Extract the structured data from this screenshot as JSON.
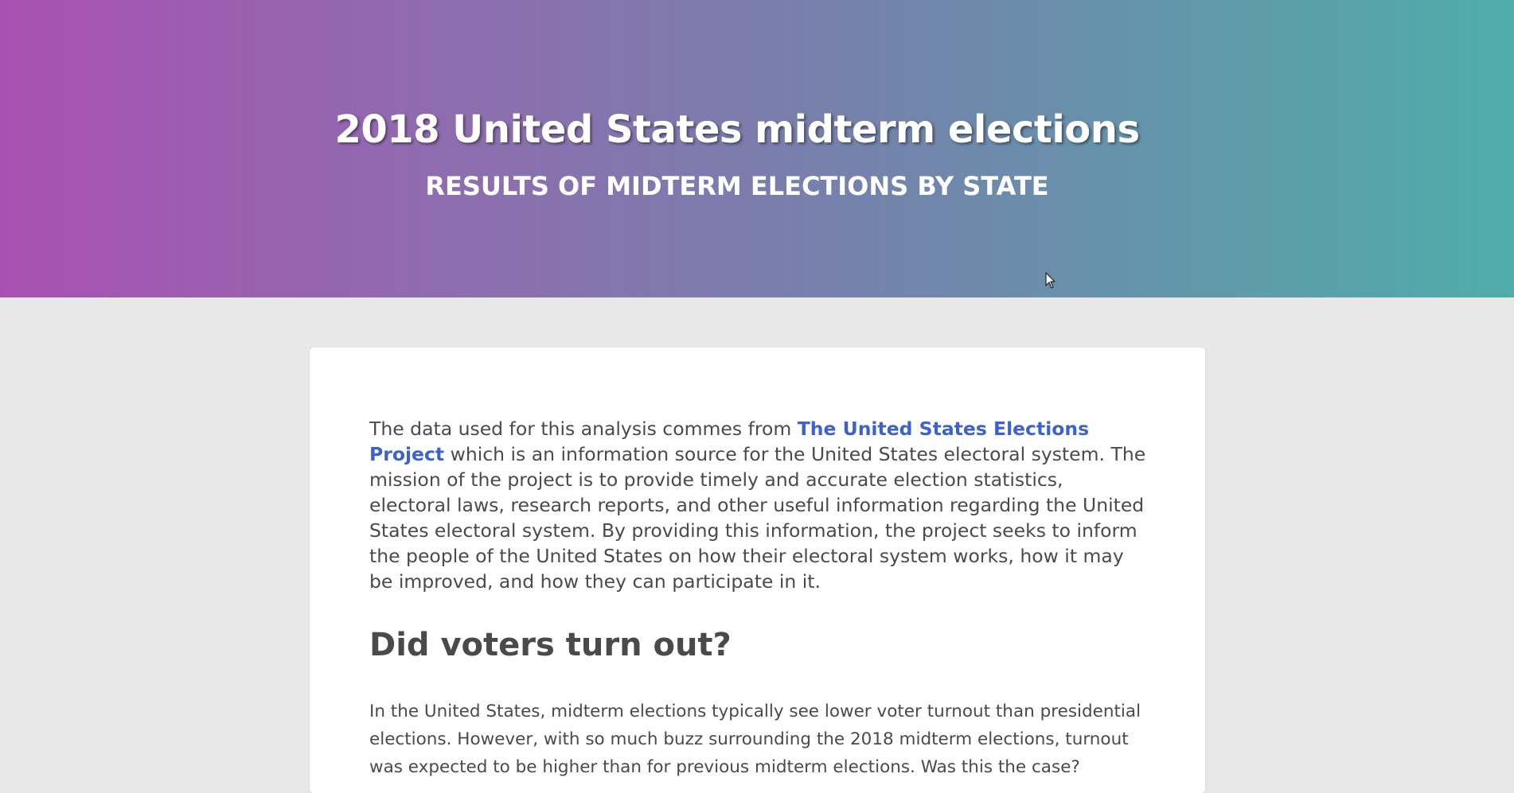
{
  "header": {
    "title": "2018 United States midterm elections",
    "subtitle": "RESULTS OF MIDTERM ELECTIONS BY STATE"
  },
  "intro": {
    "text_before_link": "The data used for this analysis commes from ",
    "link_text": "The United States Elections Project",
    "text_after_link": " which is an information source for the United States electoral system. The mission of the project is to provide timely and accurate election statistics, electoral laws, research reports, and other useful information regarding the United States electoral system. By providing this information, the project seeks to inform the people of the United States on how their electoral system works, how it may be improved, and how they can participate in it."
  },
  "section": {
    "heading": "Did voters turn out?",
    "body": "In the United States, midterm elections typically see lower voter turnout than presidential elections. However, with so much buzz surrounding the 2018 midterm elections, turnout was expected to be higher than for previous midterm elections. Was this the case?"
  },
  "colors": {
    "gradient_start": "#a951b2",
    "gradient_end": "#4fadaa",
    "link": "#3d63c9",
    "page_background": "#e8e8e8"
  },
  "icons": {
    "cursor": "mouse-pointer-icon"
  }
}
